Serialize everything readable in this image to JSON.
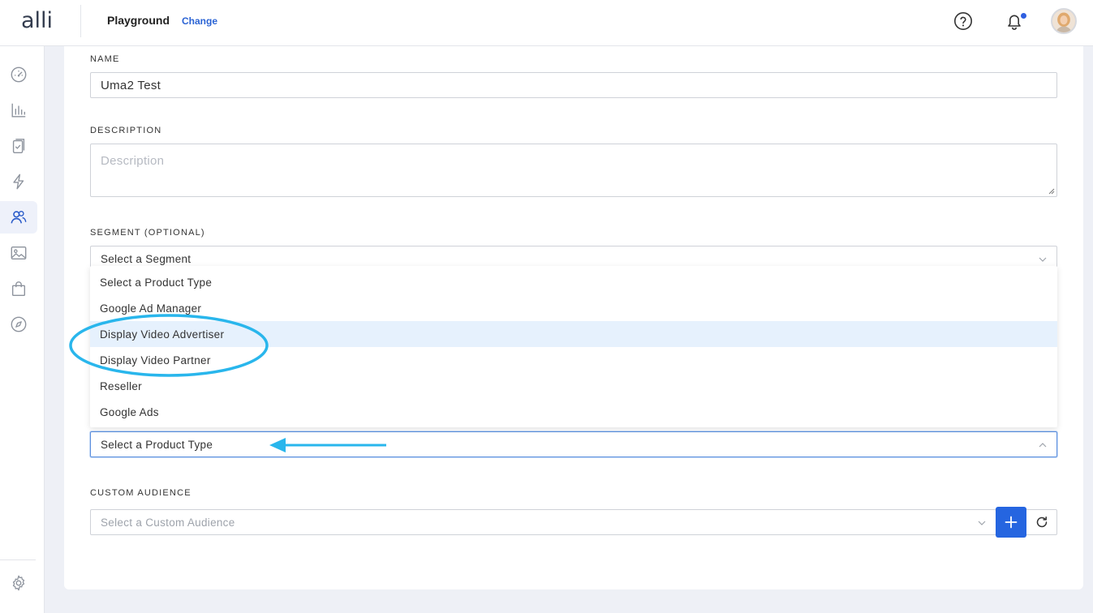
{
  "header": {
    "logo": "alli",
    "org_name": "Playground",
    "change_label": "Change"
  },
  "sidebar": {
    "items": [
      {
        "icon": "dashboard-gauge-icon"
      },
      {
        "icon": "bar-chart-icon"
      },
      {
        "icon": "clipboard-check-icon"
      },
      {
        "icon": "lightning-bolt-icon"
      },
      {
        "icon": "audiences-users-icon",
        "active": true
      },
      {
        "icon": "image-icon"
      },
      {
        "icon": "shopping-bag-icon"
      },
      {
        "icon": "compass-icon"
      }
    ],
    "footer_icon": "gear-icon"
  },
  "form": {
    "name": {
      "label": "NAME",
      "value": "Uma2 Test"
    },
    "description": {
      "label": "DESCRIPTION",
      "placeholder": "Description"
    },
    "segment": {
      "label": "SEGMENT (OPTIONAL)",
      "value": "Select a Segment"
    },
    "product_type": {
      "value": "Select a Product Type",
      "options": [
        "Select a Product Type",
        "Google Ad Manager",
        "Display Video Advertiser",
        "Display Video Partner",
        "Reseller",
        "Google Ads"
      ],
      "highlighted_option": "Display Video Advertiser"
    },
    "custom_audience": {
      "label": "CUSTOM AUDIENCE",
      "placeholder": "Select a Custom Audience"
    }
  },
  "annotation": {
    "color": "#29b6ec"
  },
  "colors": {
    "accent": "#2565e0",
    "link": "#2a63d4",
    "highlight": "#e6f1fd"
  }
}
